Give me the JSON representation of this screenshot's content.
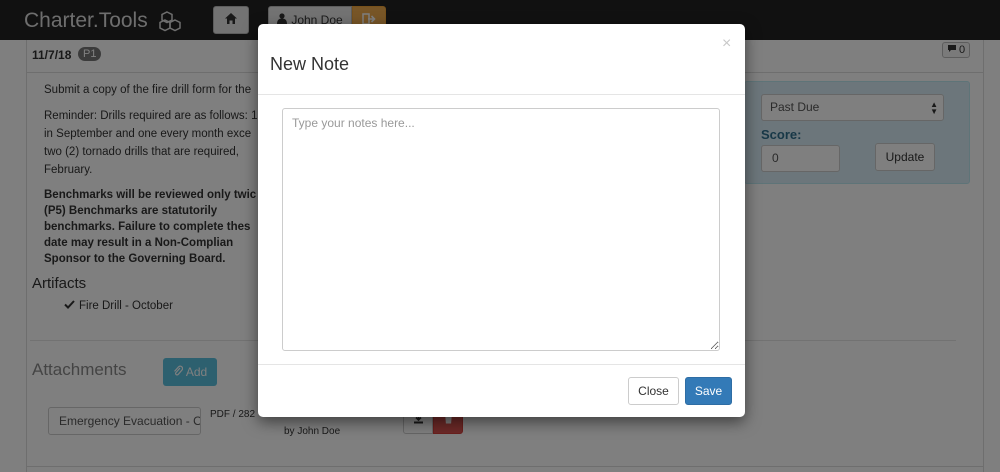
{
  "navbar": {
    "brand": "Charter.Tools",
    "brand_icon": "cubes-icon",
    "home_icon": "home-icon",
    "user_icon": "user-icon",
    "user_name": "John Doe",
    "logout_icon": "sign-out-icon",
    "colors": {
      "bar": "#222222",
      "logout": "#f0ad4e"
    }
  },
  "task": {
    "date": "11/7/18",
    "priority": "P1",
    "comment_count": "0",
    "paragraphs": [
      "Submit a copy of the fire drill form for the",
      "Reminder: Drills required are as follows: 1 in September and one every month exce two (2) tornado drills that are required, February."
    ],
    "benchmark_text": "Benchmarks will be reviewed only twic (P5) Benchmarks are statutorily benchmarks. Failure to complete thes date may result in a Non-Complian Sponsor to the Governing Board."
  },
  "status_panel": {
    "status_value": "Past Due",
    "score_label": "Score:",
    "score_value": "0",
    "update_label": "Update",
    "color": "#d9edf7"
  },
  "artifacts": {
    "title": "Artifacts",
    "items": [
      {
        "label": "Fire Drill - October",
        "icon": "check-icon"
      }
    ]
  },
  "attachments": {
    "title": "Attachments",
    "add_label": "Add",
    "add_icon": "paperclip-icon",
    "items": [
      {
        "name": "Emergency Evacuation - O",
        "meta": "PDF / 282",
        "uploaded_by": "by John Doe",
        "download_icon": "download-icon",
        "delete_icon": "trash-icon"
      }
    ]
  },
  "modal": {
    "title": "New Note",
    "close_symbol": "×",
    "textarea_placeholder": "Type your notes here...",
    "textarea_value": "",
    "close_label": "Close",
    "save_label": "Save",
    "colors": {
      "save": "#337ab7"
    }
  }
}
